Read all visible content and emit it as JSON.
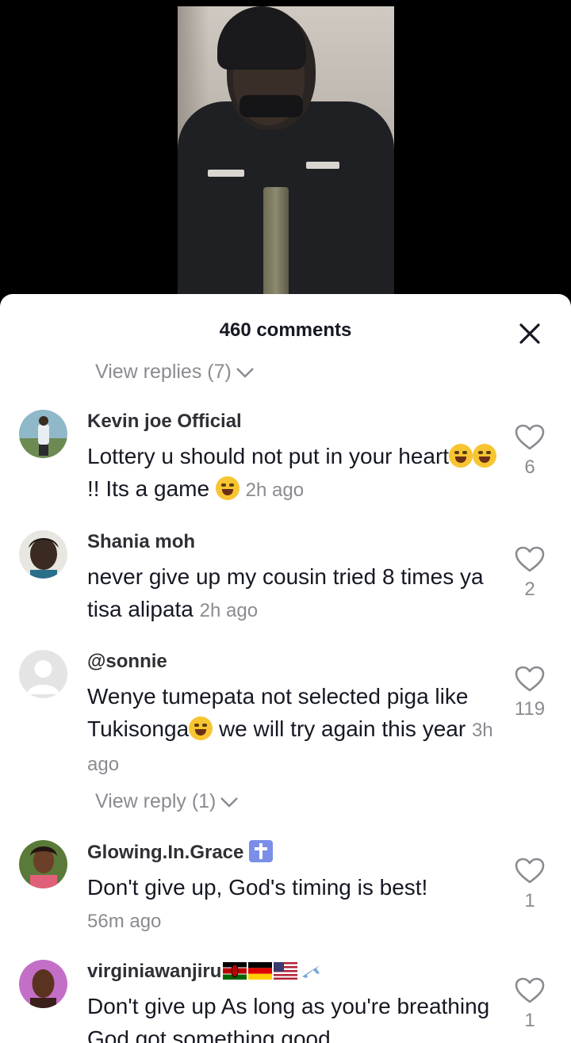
{
  "sheet": {
    "title": "460 comments",
    "close_icon": "close-icon"
  },
  "top_view_replies": "View replies (7)",
  "comments": [
    {
      "user": "Kevin joe Official",
      "text_parts": [
        "Lottery u should not put in your heart",
        "!! Its a game"
      ],
      "time": "2h ago",
      "likes": "6"
    },
    {
      "user": "Shania moh",
      "text": "never give up my cousin tried 8 times ya tisa alipata",
      "time": "2h ago",
      "likes": "2"
    },
    {
      "user": "@sonnie",
      "text_parts": [
        "Wenye tumepata not selected piga like Tukisonga",
        "we will try again this year"
      ],
      "time": "3h ago",
      "likes": "119",
      "view_reply": "View reply (1)"
    },
    {
      "user": "Glowing.In.Grace",
      "text": "Don't give up, God's timing is best!",
      "time": "56m ago",
      "likes": "1"
    },
    {
      "user": "virginiawanjiru",
      "text": "Don't give up As long as you're breathing God got something good",
      "likes": "1"
    }
  ],
  "colors": {
    "primary_text": "#161823",
    "secondary_text": "#8a8b91",
    "sheet_bg": "#ffffff"
  }
}
